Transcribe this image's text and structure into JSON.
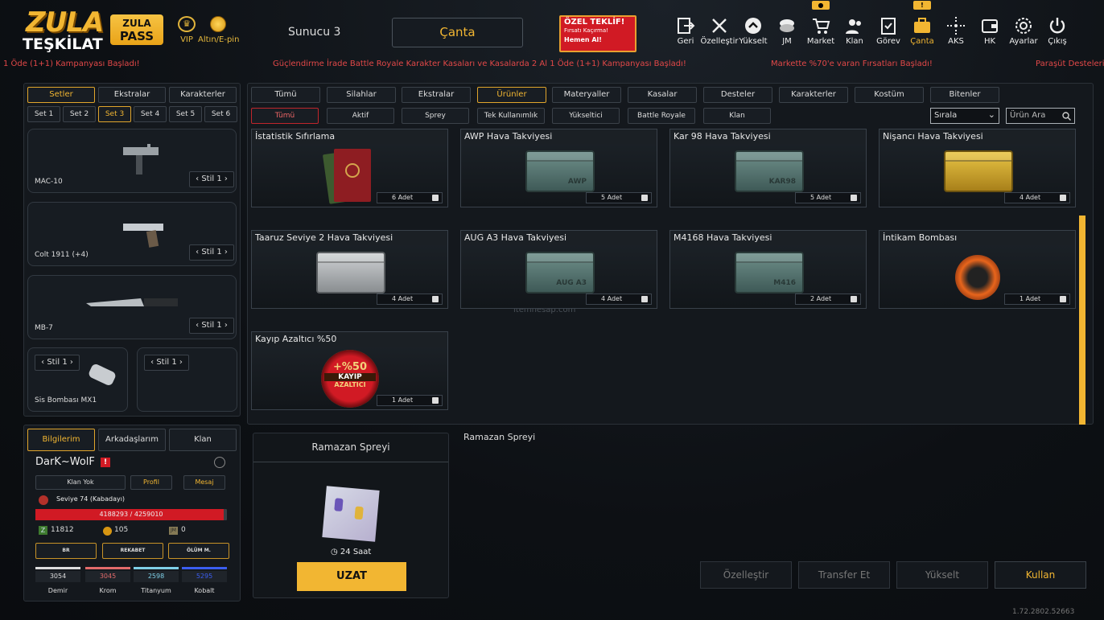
{
  "header": {
    "logo_top": "ZULA",
    "logo_bottom": "TEŞKİLAT",
    "pass_top": "ZULA",
    "pass_bottom": "PASS",
    "vip_label": "VIP",
    "gold_label": "Altın/E-pin",
    "server": "Sunucu 3",
    "current_screen": "Çanta",
    "offer_title": "ÖZEL TEKLİF!",
    "offer_sub": "Fırsatı Kaçırma!",
    "offer_cta": "Hemen Al!"
  },
  "nav": [
    {
      "label": "Geri",
      "icon": "exit-icon"
    },
    {
      "label": "Özelleştir",
      "icon": "tools-icon"
    },
    {
      "label": "Yükselt",
      "icon": "upgrade-icon"
    },
    {
      "label": "JM",
      "icon": "coins-icon"
    },
    {
      "label": "Market",
      "icon": "cart-icon",
      "tag": "●"
    },
    {
      "label": "Klan",
      "icon": "users-icon"
    },
    {
      "label": "Görev",
      "icon": "clipboard-icon"
    },
    {
      "label": "Çanta",
      "icon": "bag-icon",
      "tag": "!"
    },
    {
      "label": "AKS",
      "icon": "crosshair-icon"
    },
    {
      "label": "HK",
      "icon": "wallet-icon"
    },
    {
      "label": "Ayarlar",
      "icon": "gear-icon"
    },
    {
      "label": "Çıkış",
      "icon": "power-icon"
    }
  ],
  "ticker": [
    "1 Öde (1+1) Kampanyası Başladı!",
    "Güçlendirme İrade Battle Royale Karakter Kasaları ve Kasalarda 2 Al 1 Öde (1+1) Kampanyası Başladı!",
    "Markette %70'e varan Fırsatları Başladı!",
    "Paraşüt Desteleri"
  ],
  "left": {
    "tabs": [
      "Setler",
      "Ekstralar",
      "Karakterler"
    ],
    "sets": [
      "Set 1",
      "Set 2",
      "Set 3",
      "Set 4",
      "Set 5",
      "Set 6"
    ],
    "weapons": [
      {
        "name": "MAC-10",
        "style": "Stil 1"
      },
      {
        "name": "Colt 1911 (+4)",
        "style": "Stil 1"
      },
      {
        "name": "MB-7",
        "style": "Stil 1"
      },
      {
        "name": "Sis Bombası MX1",
        "style": "Stil 1"
      },
      {
        "name": "",
        "style": "Stil 1"
      }
    ]
  },
  "profile": {
    "tabs": [
      "Bilgilerim",
      "Arkadaşlarım",
      "Klan"
    ],
    "name": "DarK~WolF",
    "clan_btn": "Klan Yok",
    "profile_btn": "Profil",
    "message_btn": "Mesaj",
    "level": "Seviye 74 (Kabadayı)",
    "xp": "4188293 / 4259010",
    "xp_fraction": 0.983,
    "val1": "11812",
    "val2": "105",
    "val3": "0",
    "modes": [
      "BR",
      "REKABET",
      "ÖLÜM M."
    ],
    "mats": [
      {
        "value": "3054",
        "label": "Demir",
        "color": "#dddddd"
      },
      {
        "value": "3045",
        "label": "Krom",
        "color": "#e36b6b"
      },
      {
        "value": "2598",
        "label": "Titanyum",
        "color": "#7fd0e8"
      },
      {
        "value": "5295",
        "label": "Kobalt",
        "color": "#3b5ef0"
      }
    ]
  },
  "filters": {
    "main": [
      "Tümü",
      "Silahlar",
      "Ekstralar",
      "Ürünler",
      "Materyaller",
      "Kasalar",
      "Desteler",
      "Karakterler",
      "Kostüm",
      "Bitenler"
    ],
    "sub": [
      "Tümü",
      "Aktif",
      "Sprey",
      "Tek Kullanımlık",
      "Yükseltici",
      "Battle Royale",
      "Klan"
    ],
    "sort": "Sırala",
    "search_placeholder": "Ürün Ara"
  },
  "items": [
    {
      "name": "İstatistik Sıfırlama",
      "qty": "6 Adet",
      "kind": "passport"
    },
    {
      "name": "AWP Hava Takviyesi",
      "qty": "5 Adet",
      "kind": "teal",
      "mark": "AWP"
    },
    {
      "name": "Kar 98 Hava Takviyesi",
      "qty": "5 Adet",
      "kind": "teal",
      "mark": "KAR98"
    },
    {
      "name": "Nişancı Hava Takviyesi",
      "qty": "4 Adet",
      "kind": "yellow",
      "mark": ""
    },
    {
      "name": "Taaruz Seviye 2 Hava Takviyesi",
      "qty": "4 Adet",
      "kind": "silver",
      "mark": ""
    },
    {
      "name": "AUG A3 Hava Takviyesi",
      "qty": "4 Adet",
      "kind": "teal",
      "mark": "AUG A3"
    },
    {
      "name": "M4168 Hava Takviyesi",
      "qty": "2 Adet",
      "kind": "teal",
      "mark": "M416"
    },
    {
      "name": "İntikam Bombası",
      "qty": "1 Adet",
      "kind": "bomb"
    },
    {
      "name": "Kayıp Azaltıcı %50",
      "qty": "1 Adet",
      "kind": "badge",
      "badge_top": "+%50",
      "badge_mid": "KAYIP",
      "badge_bot": "AZALTICI"
    }
  ],
  "watermark": "itemhesap.com",
  "detail": {
    "title": "Ramazan Spreyi",
    "heading": "Ramazan Spreyi",
    "timer": "24 Saat",
    "extend_btn": "UZAT"
  },
  "actions": [
    "Özelleştir",
    "Transfer Et",
    "Yükselt",
    "Kullan"
  ],
  "version": "1.72.2802.52663",
  "accent": "#f2b632"
}
